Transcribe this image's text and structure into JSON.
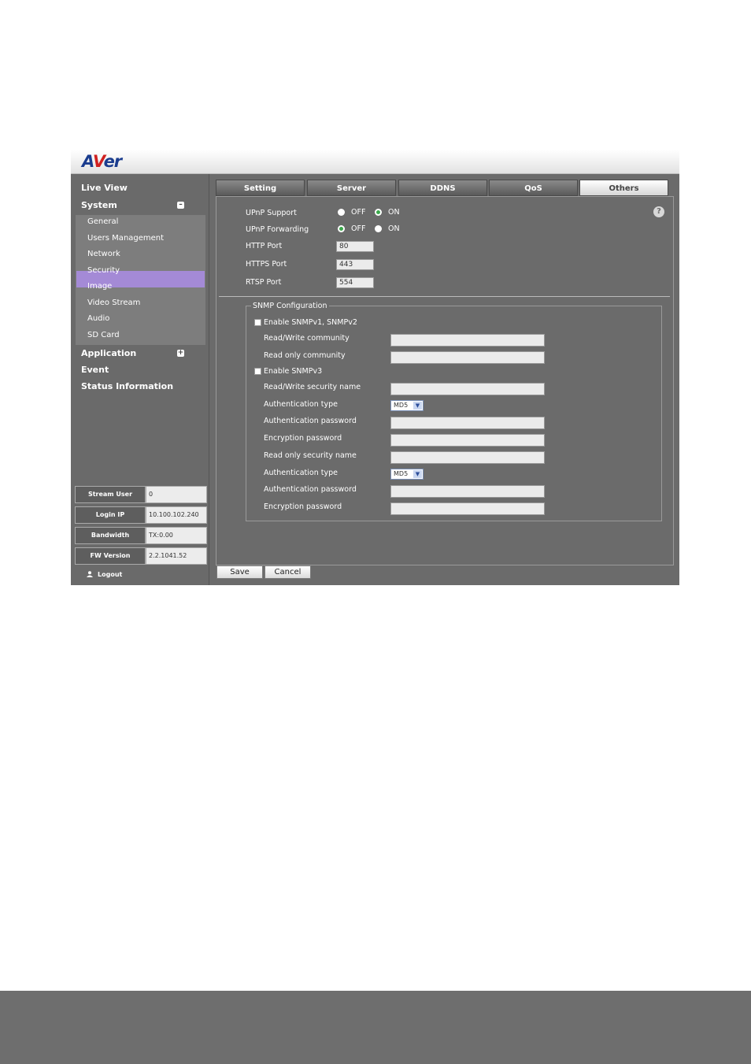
{
  "brand": {
    "logo_text_a": "A",
    "logo_text_v": "V",
    "logo_text_er": "er"
  },
  "sidebar": {
    "top_items": [
      "Live View",
      "System",
      "Application",
      "Event",
      "Status Information"
    ],
    "system_items": [
      "General",
      "Users Management",
      "Network",
      "Security",
      "Image",
      "Video Stream",
      "Audio",
      "SD Card"
    ],
    "active_item": "Network",
    "info": [
      {
        "label": "Stream User",
        "value": "0"
      },
      {
        "label": "Login IP",
        "value": "10.100.102.240"
      },
      {
        "label": "Bandwidth",
        "value": "TX:0.00"
      },
      {
        "label": "FW Version",
        "value": "2.2.1041.52"
      }
    ],
    "logout_label": "Logout"
  },
  "tabs": [
    {
      "label": "Setting"
    },
    {
      "label": "Server"
    },
    {
      "label": "DDNS"
    },
    {
      "label": "QoS"
    },
    {
      "label": "Others",
      "active": true
    }
  ],
  "network": {
    "upnp_support": {
      "label": "UPnP Support",
      "off": "OFF",
      "on": "ON",
      "selected": "ON"
    },
    "upnp_forwarding": {
      "label": "UPnP Forwarding",
      "off": "OFF",
      "on": "ON",
      "selected": "OFF"
    },
    "http_port": {
      "label": "HTTP Port",
      "value": "80"
    },
    "https_port": {
      "label": "HTTPS Port",
      "value": "443"
    },
    "rtsp_port": {
      "label": "RTSP Port",
      "value": "554"
    }
  },
  "snmp": {
    "legend": "SNMP Configuration",
    "enable_v1v2": "Enable SNMPv1, SNMPv2",
    "rw_community": "Read/Write community",
    "ro_community": "Read only community",
    "enable_v3": "Enable SNMPv3",
    "rw_security_name": "Read/Write security name",
    "auth_type_1": "Authentication type",
    "auth_type_1_value": "MD5",
    "auth_password_1": "Authentication password",
    "enc_password_1": "Encryption password",
    "ro_security_name": "Read only security name",
    "auth_type_2": "Authentication type",
    "auth_type_2_value": "MD5",
    "auth_password_2": "Authentication password",
    "enc_password_2": "Encryption password"
  },
  "actions": {
    "save": "Save",
    "cancel": "Cancel"
  },
  "icons": {
    "help": "help-icon",
    "user": "user-icon",
    "expand": "minus-icon",
    "collapse": "plus-icon"
  },
  "colors": {
    "active_nav": "#a48ad6",
    "radio_on": "#3aa84b",
    "logo_blue": "#1a3c8e",
    "logo_red": "#d02020"
  }
}
